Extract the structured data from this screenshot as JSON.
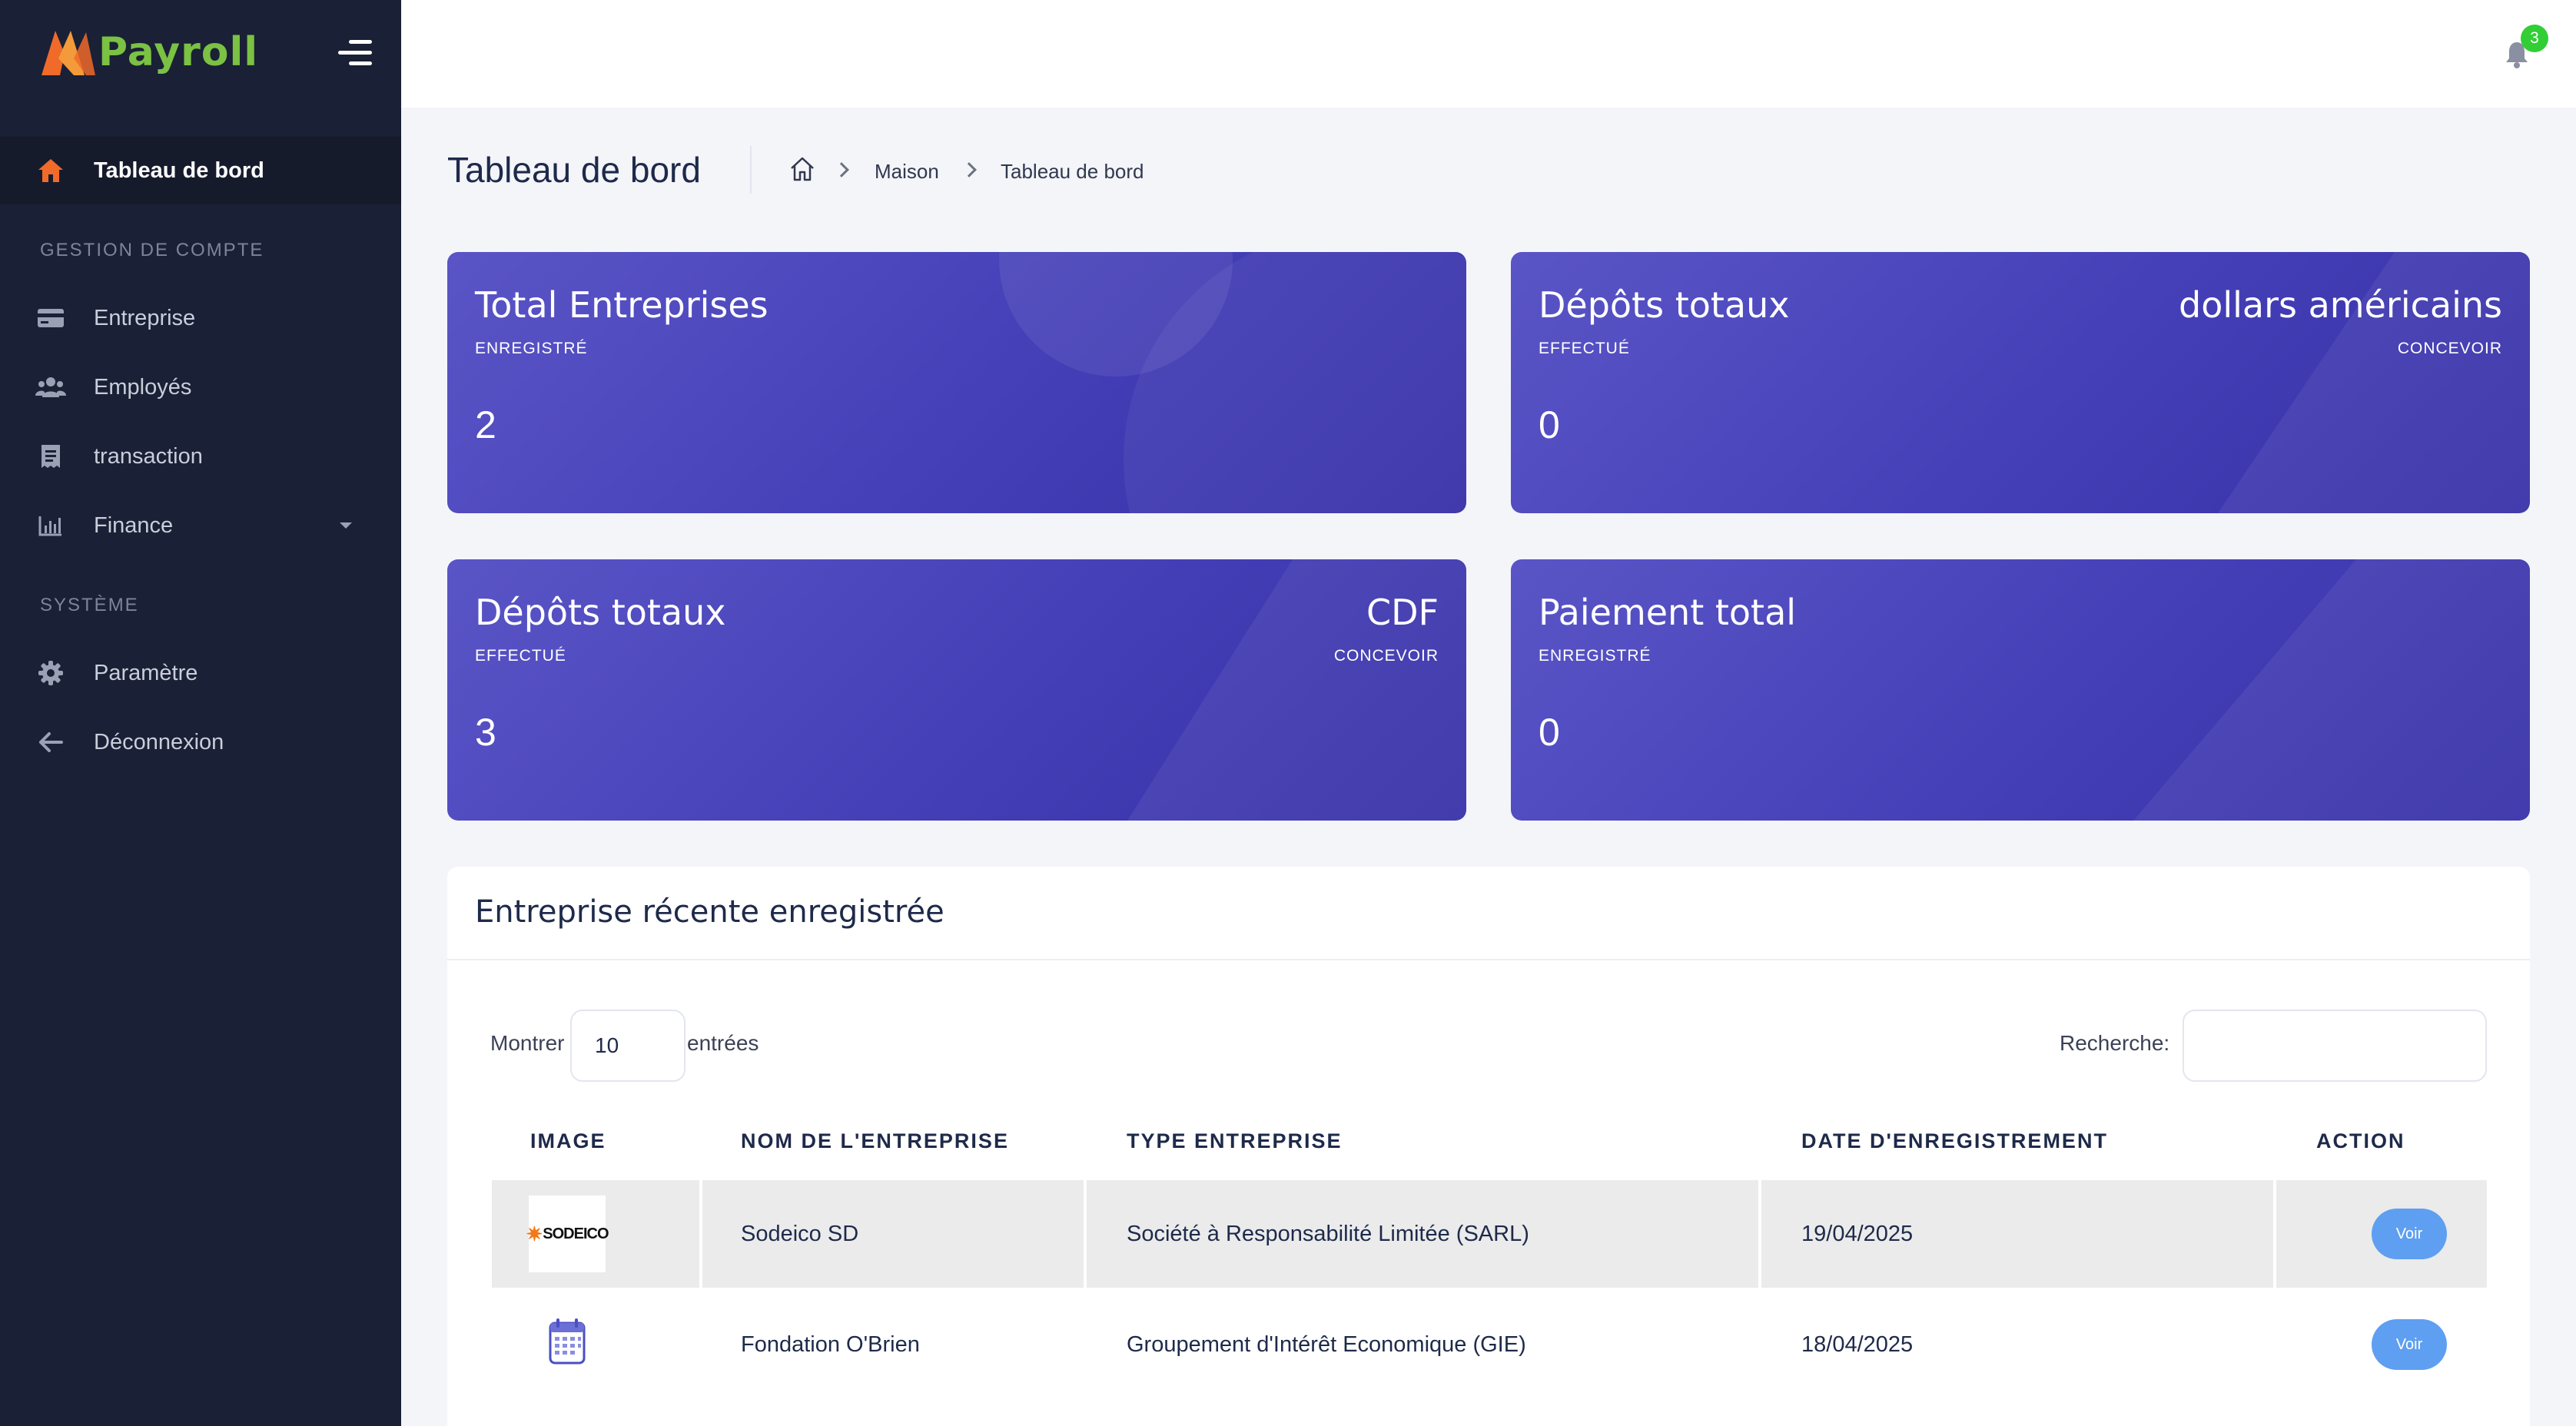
{
  "app": {
    "logo_text": "Payroll"
  },
  "sidebar": {
    "active": {
      "label": "Tableau de bord",
      "icon": "home-icon"
    },
    "sections": [
      {
        "heading": "GESTION DE COMPTE",
        "items": [
          {
            "label": "Entreprise",
            "icon": "credit-card-icon"
          },
          {
            "label": "Employés",
            "icon": "users-icon"
          },
          {
            "label": "transaction",
            "icon": "receipt-icon"
          },
          {
            "label": "Finance",
            "icon": "bar-chart-icon"
          }
        ]
      },
      {
        "heading": "SYSTÈME",
        "items": [
          {
            "label": "Paramètre",
            "icon": "gear-icon"
          },
          {
            "label": "Déconnexion",
            "icon": "arrow-left-icon"
          }
        ]
      }
    ]
  },
  "topbar": {
    "notification_count": "3"
  },
  "header": {
    "title": "Tableau de bord",
    "breadcrumb": [
      "Maison",
      "Tableau de bord"
    ]
  },
  "cards": [
    {
      "title": "Total Entreprises",
      "sub": "ENREGISTRÉ",
      "value": "2",
      "right_title": "",
      "right_sub": ""
    },
    {
      "title": "Dépôts totaux",
      "sub": "EFFECTUÉ",
      "value": "0",
      "right_title": "dollars américains",
      "right_sub": "CONCEVOIR"
    },
    {
      "title": "Dépôts totaux",
      "sub": "EFFECTUÉ",
      "value": "3",
      "right_title": "CDF",
      "right_sub": "CONCEVOIR"
    },
    {
      "title": "Paiement total",
      "sub": "ENREGISTRÉ",
      "value": "0",
      "right_title": "",
      "right_sub": ""
    }
  ],
  "table_panel": {
    "title": "Entreprise récente enregistrée",
    "show_label": "Montrer",
    "show_value": "10",
    "entries_label": "entrées",
    "search_label": "Recherche:",
    "search_value": "",
    "columns": [
      "IMAGE",
      "NOM DE L'ENTREPRISE",
      "TYPE ENTREPRISE",
      "DATE D'ENREGISTREMENT",
      "ACTION"
    ],
    "rows": [
      {
        "logo_text": "SODEICO",
        "name": "Sodeico SD",
        "type": "Société à Responsabilité Limitée (SARL)",
        "date": "19/04/2025",
        "action": "Voir"
      },
      {
        "logo_text": "",
        "name": "Fondation O'Brien",
        "type": "Groupement d'Intérêt Economique (GIE)",
        "date": "18/04/2025",
        "action": "Voir"
      }
    ]
  },
  "colors": {
    "sidebar_bg": "#1a2035",
    "accent_orange": "#f06a2a",
    "logo_green": "#7bc144",
    "card_start": "#5a55c6",
    "card_end": "#3730a8",
    "button_blue": "#5e9ff1",
    "badge_green": "#31ce36"
  }
}
